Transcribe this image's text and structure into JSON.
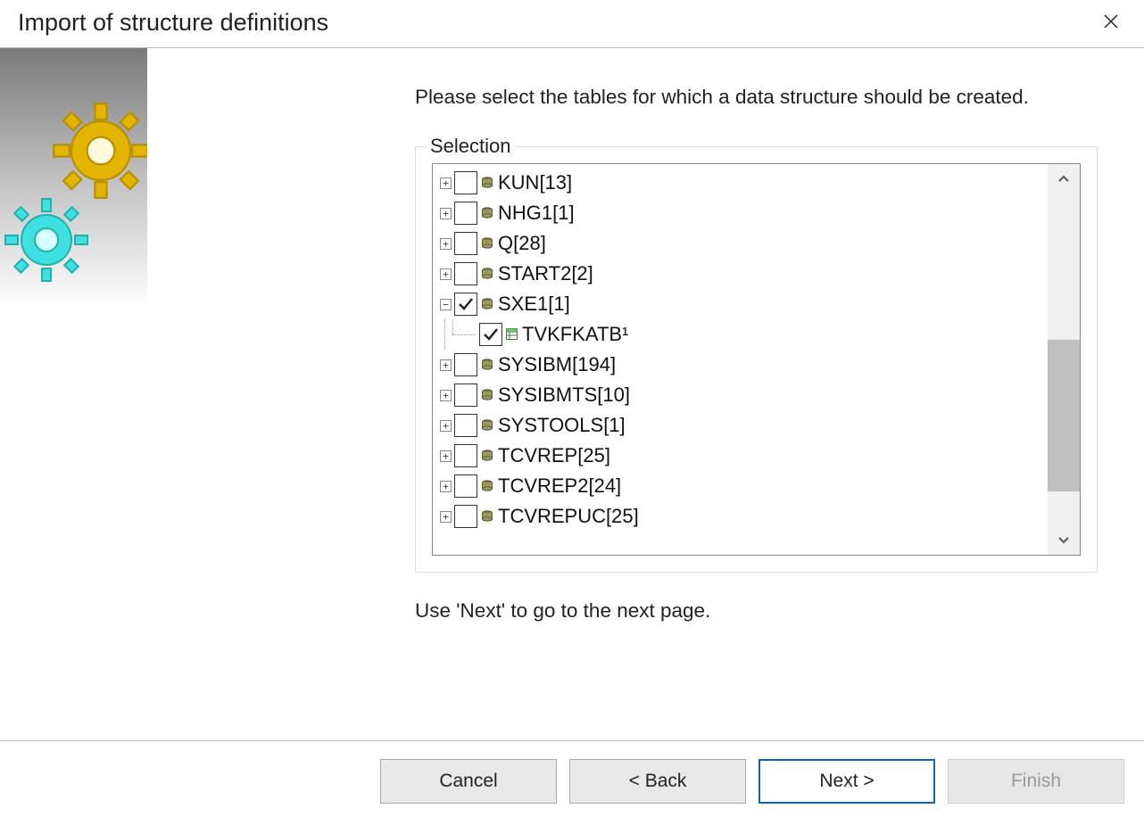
{
  "title": "Import of structure definitions",
  "instruction": "Please select the tables for which a data structure should be created.",
  "selection_legend": "Selection",
  "tree": [
    {
      "label": "KUN[13]",
      "expanded": false,
      "checked": false,
      "type": "schema"
    },
    {
      "label": "NHG1[1]",
      "expanded": false,
      "checked": false,
      "type": "schema"
    },
    {
      "label": "Q[28]",
      "expanded": false,
      "checked": false,
      "type": "schema"
    },
    {
      "label": "START2[2]",
      "expanded": false,
      "checked": false,
      "type": "schema"
    },
    {
      "label": "SXE1[1]",
      "expanded": true,
      "checked": true,
      "type": "schema",
      "children": [
        {
          "label": "TVKFKATB¹",
          "checked": true,
          "type": "table"
        }
      ]
    },
    {
      "label": "SYSIBM[194]",
      "expanded": false,
      "checked": false,
      "type": "schema"
    },
    {
      "label": "SYSIBMTS[10]",
      "expanded": false,
      "checked": false,
      "type": "schema"
    },
    {
      "label": "SYSTOOLS[1]",
      "expanded": false,
      "checked": false,
      "type": "schema"
    },
    {
      "label": "TCVREP[25]",
      "expanded": false,
      "checked": false,
      "type": "schema"
    },
    {
      "label": "TCVREP2[24]",
      "expanded": false,
      "checked": false,
      "type": "schema"
    },
    {
      "label": "TCVREPUC[25]",
      "expanded": false,
      "checked": false,
      "type": "schema"
    }
  ],
  "hint": "Use 'Next' to go to the next page.",
  "buttons": {
    "cancel": "Cancel",
    "back": "< Back",
    "next": "Next >",
    "finish": "Finish"
  }
}
